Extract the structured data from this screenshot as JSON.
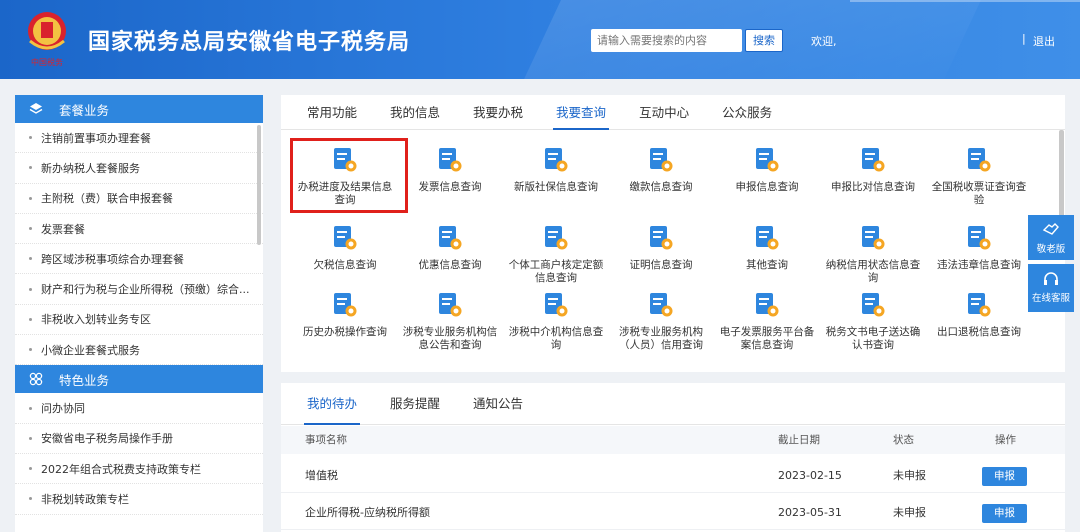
{
  "header": {
    "title": "国家税务总局安徽省电子税务局",
    "search_placeholder": "请输入需要搜索的内容",
    "search_button": "搜索",
    "welcome": "欢迎,",
    "separator": "|",
    "logout": "退出",
    "emblem_text": "中国税务"
  },
  "sidebar": {
    "section1": {
      "title": "套餐业务",
      "items": [
        "注销前置事项办理套餐",
        "新办纳税人套餐服务",
        "主附税（费）联合申报套餐",
        "发票套餐",
        "跨区域涉税事项综合办理套餐",
        "财产和行为税与企业所得税（预缴）综合...",
        "非税收入划转业务专区",
        "小微企业套餐式服务"
      ]
    },
    "section2": {
      "title": "特色业务",
      "items": [
        "问办协同",
        "安徽省电子税务局操作手册",
        "2022年组合式税费支持政策专栏",
        "非税划转政策专栏"
      ]
    }
  },
  "function_panel": {
    "tabs": [
      "常用功能",
      "我的信息",
      "我要办税",
      "我要查询",
      "互动中心",
      "公众服务"
    ],
    "active_tab": "我要查询",
    "items": [
      {
        "label": "办税进度及结果信息查询",
        "icon": "search-progress-icon"
      },
      {
        "label": "发票信息查询",
        "icon": "invoice-search-icon"
      },
      {
        "label": "新版社保信息查询",
        "icon": "social-security-icon"
      },
      {
        "label": "缴款信息查询",
        "icon": "payment-icon"
      },
      {
        "label": "申报信息查询",
        "icon": "declaration-icon"
      },
      {
        "label": "申报比对信息查询",
        "icon": "compare-icon"
      },
      {
        "label": "全国税收票证查询查验",
        "icon": "tax-voucher-icon"
      },
      {
        "label": "欠税信息查询",
        "icon": "arrears-icon"
      },
      {
        "label": "优惠信息查询",
        "icon": "preference-icon"
      },
      {
        "label": "个体工商户核定定额信息查询",
        "icon": "business-quota-icon"
      },
      {
        "label": "证明信息查询",
        "icon": "certificate-icon"
      },
      {
        "label": "其他查询",
        "icon": "other-icon"
      },
      {
        "label": "纳税信用状态信息查询",
        "icon": "credit-icon"
      },
      {
        "label": "违法违章信息查询",
        "icon": "violation-icon"
      },
      {
        "label": "历史办税操作查询",
        "icon": "history-icon"
      },
      {
        "label": "涉税专业服务机构信息公告和查询",
        "icon": "agency-notice-icon"
      },
      {
        "label": "涉税中介机构信息查询",
        "icon": "intermediary-icon"
      },
      {
        "label": "涉税专业服务机构（人员）信用查询",
        "icon": "agency-credit-icon"
      },
      {
        "label": "电子发票服务平台备案信息查询",
        "icon": "e-invoice-icon"
      },
      {
        "label": "税务文书电子送达确认书查询",
        "icon": "document-delivery-icon"
      },
      {
        "label": "出口退税信息查询",
        "icon": "export-refund-icon"
      }
    ]
  },
  "float_buttons": {
    "elderly": "敬老版",
    "service": "在线客服"
  },
  "todo_panel": {
    "tabs": [
      "我的待办",
      "服务提醒",
      "通知公告"
    ],
    "active_tab": "我的待办",
    "columns": [
      "事项名称",
      "截止日期",
      "状态",
      "操作"
    ],
    "rows": [
      {
        "name": "增值税",
        "deadline": "2023-02-15",
        "status": "未申报",
        "action": "申报"
      },
      {
        "name": "企业所得税-应纳税所得额",
        "deadline": "2023-05-31",
        "status": "未申报",
        "action": "申报"
      }
    ]
  },
  "colors": {
    "brand_blue": "#1b66c9",
    "accent_blue": "#2e86de",
    "highlight_red": "#e0201b",
    "icon_orange": "#f5a623"
  }
}
